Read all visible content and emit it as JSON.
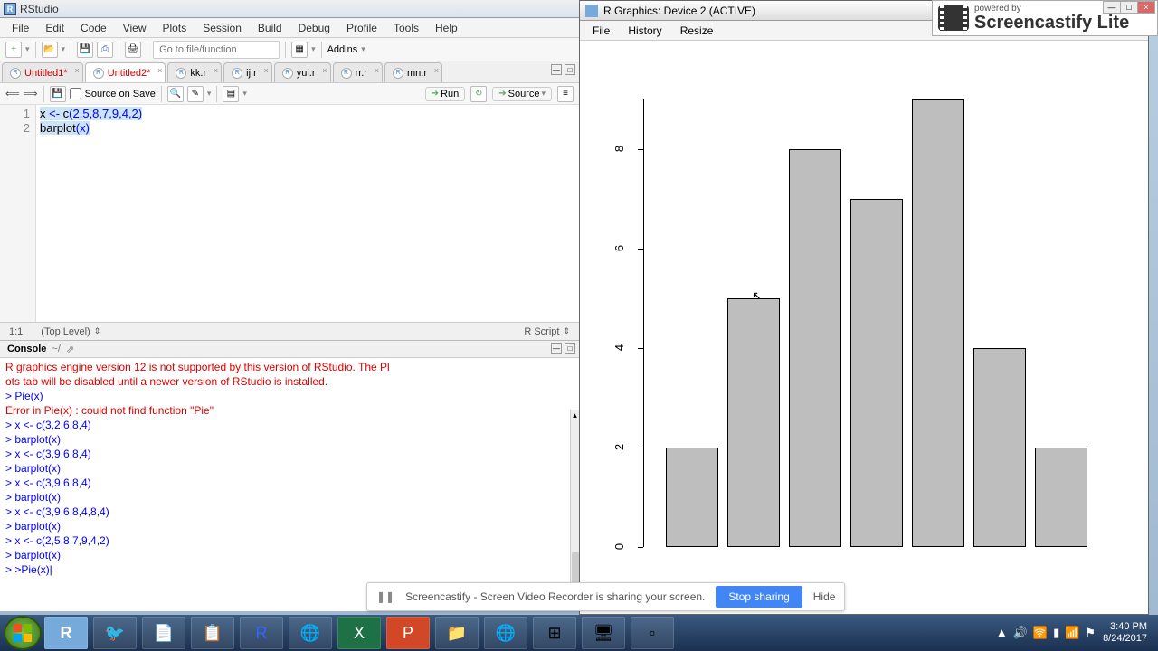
{
  "rstudio": {
    "title": "RStudio",
    "menus": [
      "File",
      "Edit",
      "Code",
      "View",
      "Plots",
      "Session",
      "Build",
      "Debug",
      "Profile",
      "Tools",
      "Help"
    ],
    "goto_placeholder": "Go to file/function",
    "addins_label": "Addins",
    "tabs": [
      {
        "name": "Untitled1*"
      },
      {
        "name": "Untitled2*"
      },
      {
        "name": "kk.r"
      },
      {
        "name": "ij.r"
      },
      {
        "name": "yui.r"
      },
      {
        "name": "rr.r"
      },
      {
        "name": "mn.r"
      }
    ],
    "editor_toolbar": {
      "source_on_save": "Source on Save",
      "run": "Run",
      "source": "Source"
    },
    "code": {
      "line1_pre": "x ",
      "line1_op": "<- ",
      "line1_fn": "c",
      "line1_args": "(2,5,8,7,9,4,2)",
      "line2_fn": "barplot",
      "line2_args": "(x)"
    },
    "editor_status": {
      "pos": "1:1",
      "scope": "(Top Level)",
      "type": "R Script"
    },
    "console": {
      "title": "Console",
      "path": "~/",
      "lines": [
        {
          "cls": "err",
          "text": "R graphics engine version 12 is not supported by this version of RStudio. The Pl"
        },
        {
          "cls": "err",
          "text": "ots tab will be disabled until a newer version of RStudio is installed."
        },
        {
          "cls": "prompt",
          "text": "> Pie(x)"
        },
        {
          "cls": "err",
          "text": "Error in Pie(x) : could not find function \"Pie\""
        },
        {
          "cls": "prompt",
          "text": "> x <- c(3,2,6,8,4)"
        },
        {
          "cls": "prompt",
          "text": "> barplot(x)"
        },
        {
          "cls": "prompt",
          "text": "> x <- c(3,9,6,8,4)"
        },
        {
          "cls": "prompt",
          "text": "> barplot(x)"
        },
        {
          "cls": "prompt",
          "text": "> x <- c(3,9,6,8,4)"
        },
        {
          "cls": "prompt",
          "text": "> barplot(x)"
        },
        {
          "cls": "prompt",
          "text": "> x <- c(3,9,6,8,4,8,4)"
        },
        {
          "cls": "prompt",
          "text": "> barplot(x)"
        },
        {
          "cls": "prompt",
          "text": "> x <- c(2,5,8,7,9,4,2)"
        },
        {
          "cls": "prompt",
          "text": "> barplot(x)"
        },
        {
          "cls": "prompt",
          "text": "> >Pie(x)|"
        }
      ]
    }
  },
  "graphics": {
    "title": "R Graphics: Device 2 (ACTIVE)",
    "menus": [
      "File",
      "History",
      "Resize"
    ]
  },
  "chart_data": {
    "type": "bar",
    "values": [
      2,
      5,
      8,
      7,
      9,
      4,
      2
    ],
    "ylim": [
      0,
      9
    ],
    "yticks": [
      0,
      2,
      4,
      6,
      8
    ],
    "title": "",
    "xlabel": "",
    "ylabel": ""
  },
  "screencastify": {
    "text": "Screencastify - Screen Video Recorder is sharing your screen.",
    "stop": "Stop sharing",
    "hide": "Hide",
    "powered": "powered by",
    "brand": "Screencastify Lite"
  },
  "taskbar": {
    "time": "3:40 PM",
    "date": "8/24/2017"
  }
}
